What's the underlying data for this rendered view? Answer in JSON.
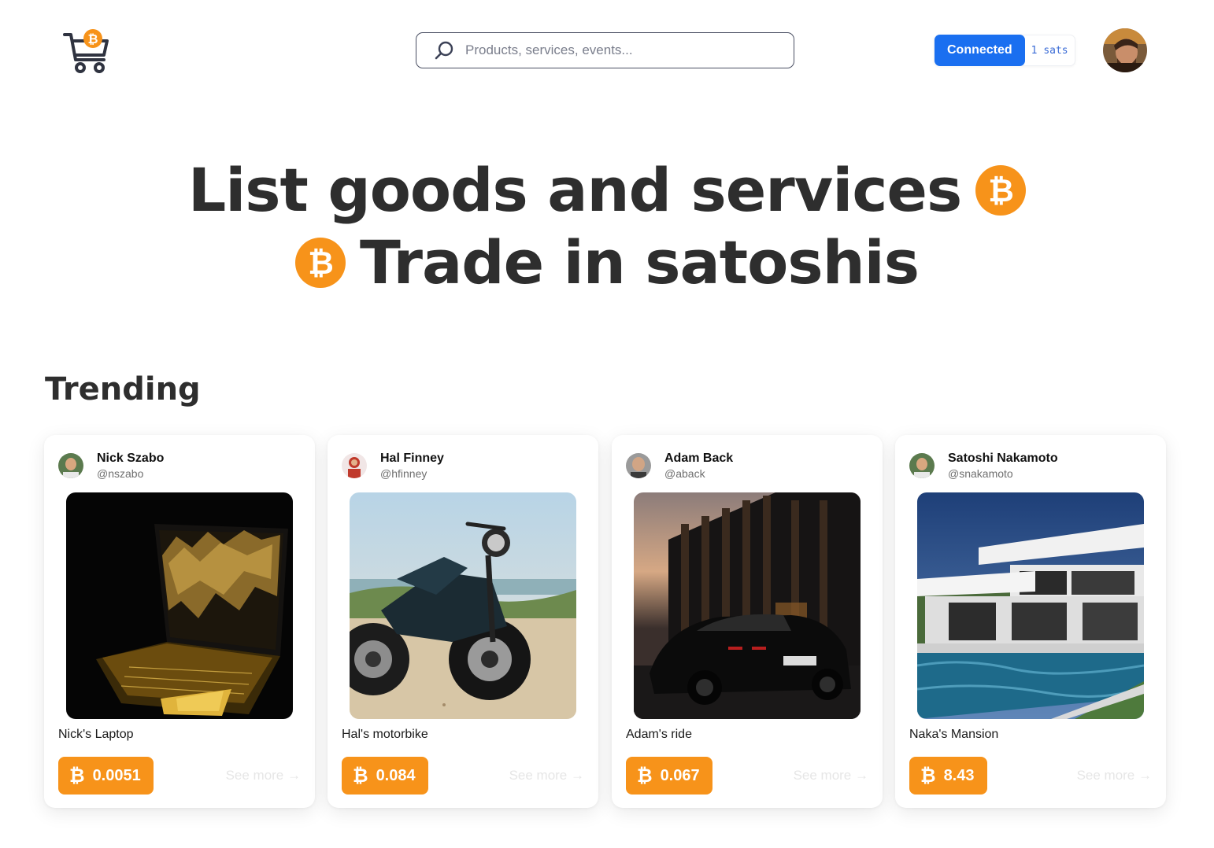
{
  "header": {
    "search_placeholder": "Products, services, events...",
    "connect_label": "Connected",
    "balance": "1 sats"
  },
  "hero": {
    "line1": "List goods and services",
    "line2": "Trade in satoshis"
  },
  "trending": {
    "title": "Trending",
    "see_more_label": "See more →",
    "price_symbol": "₿",
    "items": [
      {
        "seller_name": "Nick Szabo",
        "seller_handle": "@nszabo",
        "title": "Nick's Laptop",
        "price": "0.0051"
      },
      {
        "seller_name": "Hal Finney",
        "seller_handle": "@hfinney",
        "title": "Hal's motorbike",
        "price": "0.084"
      },
      {
        "seller_name": "Adam Back",
        "seller_handle": "@aback",
        "title": "Adam's ride",
        "price": "0.067"
      },
      {
        "seller_name": "Satoshi Nakamoto",
        "seller_handle": "@snakamoto",
        "title": "Naka's Mansion",
        "price": "8.43"
      }
    ]
  },
  "colors": {
    "bitcoin_orange": "#f7931a",
    "connect_blue": "#1a6ff0",
    "heading": "#2e2e2e"
  },
  "icons": {
    "logo": "bitcoin-shopping-cart-icon",
    "search": "search-icon",
    "coin": "bitcoin-coin-icon"
  }
}
